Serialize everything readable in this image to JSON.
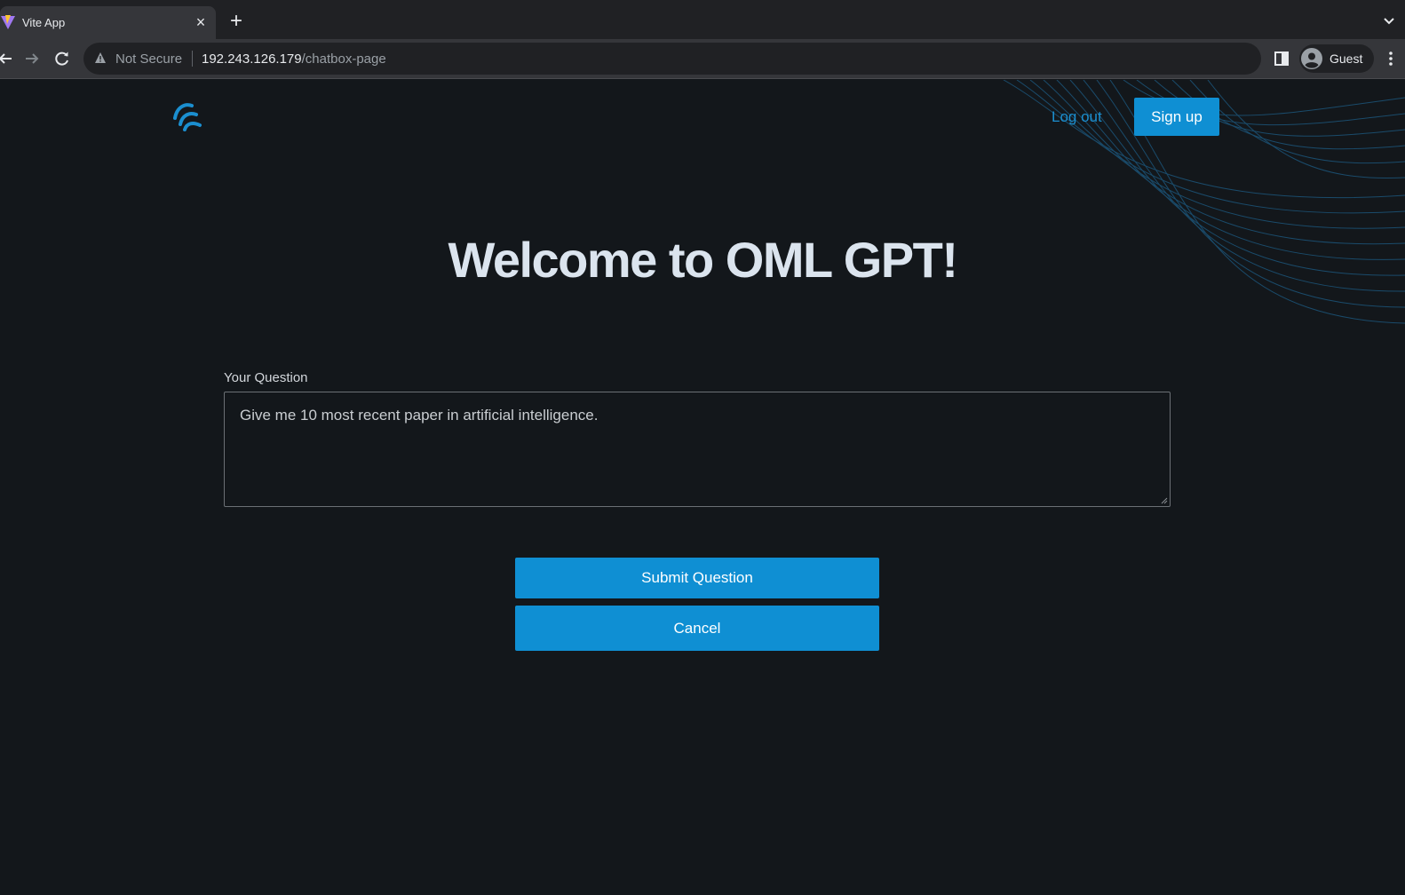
{
  "browser": {
    "tab_title": "Vite App",
    "tab_close": "×",
    "new_tab": "+",
    "security_label": "Not Secure",
    "url_host": "192.243.126.179",
    "url_path": "/chatbox-page",
    "profile_name": "Guest"
  },
  "header": {
    "logout_label": "Log out",
    "signup_label": "Sign up"
  },
  "main": {
    "title": "Welcome to OML GPT!",
    "question_label": "Your Question",
    "question_value": "Give me 10 most recent paper in artificial intelligence.",
    "submit_label": "Submit Question",
    "cancel_label": "Cancel"
  },
  "colors": {
    "accent": "#0f8fd3",
    "link": "#1b8fd0",
    "background": "#13171b",
    "title": "#dbe4ee"
  },
  "icons": [
    "vite-favicon-icon",
    "close-icon",
    "plus-icon",
    "chevron-down-icon",
    "back-arrow-icon",
    "forward-arrow-icon",
    "reload-icon",
    "warning-icon",
    "side-panel-icon",
    "profile-avatar-icon",
    "kebab-menu-icon",
    "brand-logo-icon"
  ]
}
